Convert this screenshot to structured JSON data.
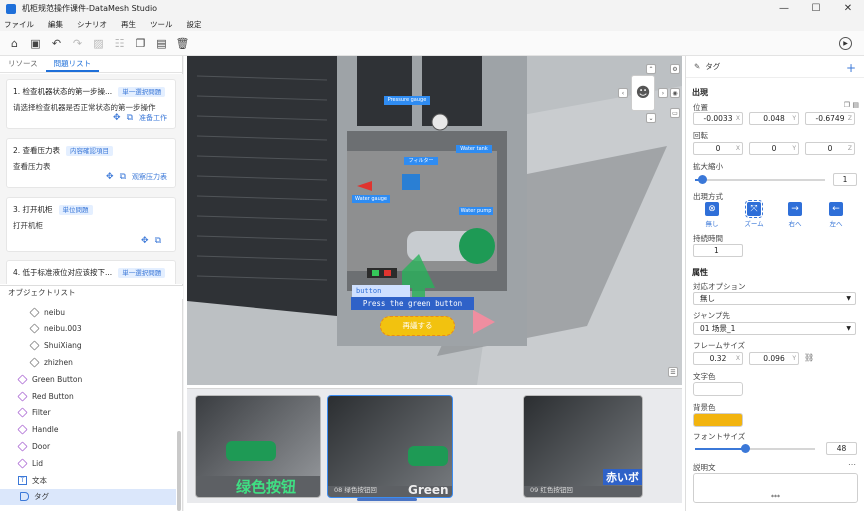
{
  "window": {
    "title": "机柜规范操作课件-DataMesh Studio"
  },
  "menu": [
    "ファイル",
    "編集",
    "シナリオ",
    "再生",
    "ツール",
    "設定"
  ],
  "left": {
    "tabs": [
      "リソース",
      "問題リスト"
    ],
    "questions": [
      {
        "title": "1. 检查机器状态的第一步操...",
        "badge": "単一選択問題",
        "desc": "请选择检查机器是否正常状态的第一步操作",
        "action": "准备工作"
      },
      {
        "title": "2. 查看压力表",
        "badge": "内容確認項目",
        "desc": "查看压力表",
        "action": "观察压力表"
      },
      {
        "title": "3. 打开机柜",
        "badge": "単位問題",
        "desc": "打开机柜",
        "action": ""
      },
      {
        "title": "4. 低于标准液位对应该按下...",
        "badge": "単一選択問題",
        "desc": "",
        "action": ""
      }
    ],
    "object_header": "オブジェクトリスト",
    "objects": [
      {
        "label": "neibu",
        "kind": "cube"
      },
      {
        "label": "neibu.003",
        "kind": "cube"
      },
      {
        "label": "ShuiXiang",
        "kind": "cube"
      },
      {
        "label": "zhizhen",
        "kind": "cube"
      },
      {
        "label": "Green Button",
        "kind": "pcube"
      },
      {
        "label": "Red Button",
        "kind": "pcube"
      },
      {
        "label": "Filter",
        "kind": "pcube"
      },
      {
        "label": "Handle",
        "kind": "pcube"
      },
      {
        "label": "Door",
        "kind": "pcube"
      },
      {
        "label": "Lid",
        "kind": "pcube"
      },
      {
        "label": "文本",
        "kind": "txt"
      },
      {
        "label": "タグ",
        "kind": "tag"
      }
    ]
  },
  "scene": {
    "label_pressure": "Pressure gauge",
    "label_filter": "フィルター",
    "label_tank": "Water tank",
    "label_gauge2": "Water gauge",
    "label_pump": "Water pump",
    "button_label": "button",
    "press_text": "Press the green button",
    "yellow_btn": "再議する"
  },
  "timeline": [
    {
      "caption": "",
      "big": "绿色按钮"
    },
    {
      "caption": "08  绿色按钮回",
      "big": "Green"
    },
    {
      "caption": "09  红色按钮回",
      "big": "赤いボ"
    }
  ],
  "right": {
    "header": "タグ",
    "appear": "出現",
    "position": "位置",
    "pos": [
      "-0.0033",
      "0.048",
      "-0.6749"
    ],
    "rotation": "回転",
    "rot": [
      "0",
      "0",
      "0"
    ],
    "scale": "拡大縮小",
    "scale_val": "1",
    "scale_fraction": 0.05,
    "appear_mode": "出現方式",
    "modes": [
      "無し",
      "ズーム",
      "右へ",
      "左へ"
    ],
    "duration": "持続時間",
    "duration_val": "1",
    "props": "属性",
    "option": "対応オプション",
    "option_val": "無し",
    "jump": "ジャンプ先",
    "jump_val": "01  场景_1",
    "frame": "フレームサイズ",
    "frame_vals": [
      "0.32",
      "0.096"
    ],
    "text_color": "文字色",
    "text_color_hex": "#ffffff",
    "bg_color": "背景色",
    "bg_color_hex": "#f2b40f",
    "font_size": "フォントサイズ",
    "font_size_val": "48",
    "font_fraction": 0.42,
    "desc": "説明文",
    "desc_val": "***"
  }
}
